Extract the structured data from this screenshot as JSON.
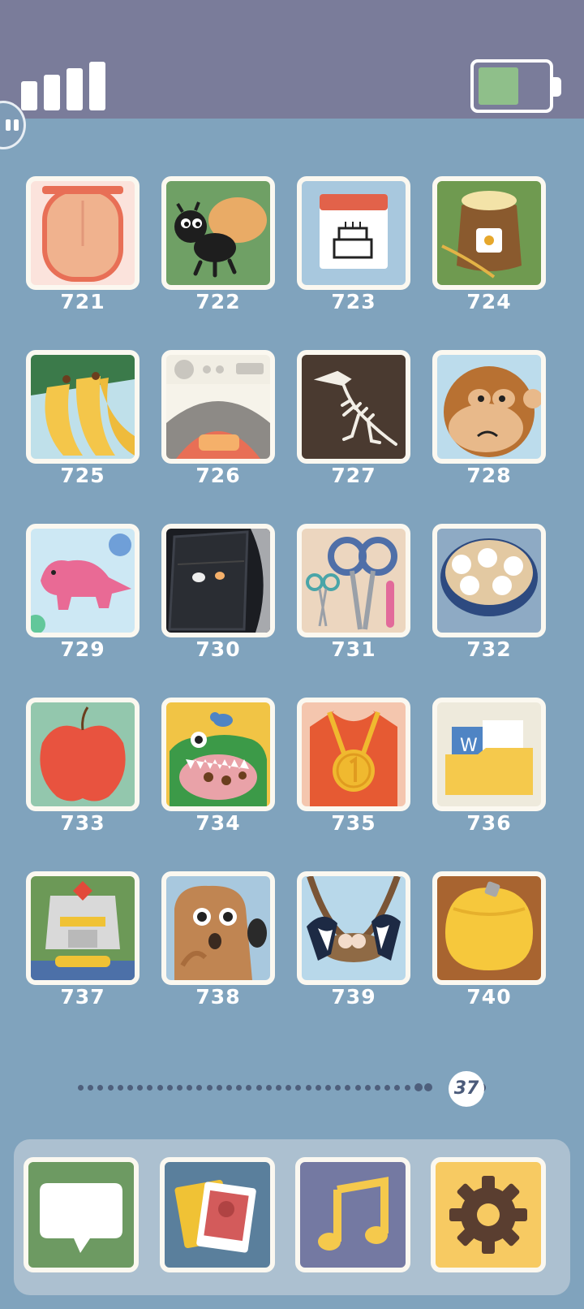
{
  "status": {
    "signal_icon": "signal-bars-icon",
    "battery_icon": "battery-icon",
    "battery_level": 0.6
  },
  "levels": [
    {
      "number": "721",
      "icon": "tongue-icon"
    },
    {
      "number": "722",
      "icon": "ant-carrying-bread-icon"
    },
    {
      "number": "723",
      "icon": "birthday-calendar-icon"
    },
    {
      "number": "724",
      "icon": "flour-sack-icon"
    },
    {
      "number": "725",
      "icon": "bananas-icon"
    },
    {
      "number": "726",
      "icon": "oven-icon"
    },
    {
      "number": "727",
      "icon": "dinosaur-fossil-icon"
    },
    {
      "number": "728",
      "icon": "monkey-icon"
    },
    {
      "number": "729",
      "icon": "pink-triceratops-icon"
    },
    {
      "number": "730",
      "icon": "dark-car-window-icon"
    },
    {
      "number": "731",
      "icon": "scissors-icon"
    },
    {
      "number": "732",
      "icon": "rice-balls-bowl-icon"
    },
    {
      "number": "733",
      "icon": "apple-icon"
    },
    {
      "number": "734",
      "icon": "crocodile-bird-icon"
    },
    {
      "number": "735",
      "icon": "gold-medal-icon"
    },
    {
      "number": "736",
      "icon": "folder-icon"
    },
    {
      "number": "737",
      "icon": "robot-icon"
    },
    {
      "number": "738",
      "icon": "worried-bear-icon"
    },
    {
      "number": "739",
      "icon": "magpies-nest-icon"
    },
    {
      "number": "740",
      "icon": "yellow-coin-purse-icon"
    }
  ],
  "pager": {
    "current_page": "37"
  },
  "dock": [
    {
      "icon": "messages-icon"
    },
    {
      "icon": "photos-icon"
    },
    {
      "icon": "music-icon"
    },
    {
      "icon": "settings-gear-icon"
    }
  ]
}
